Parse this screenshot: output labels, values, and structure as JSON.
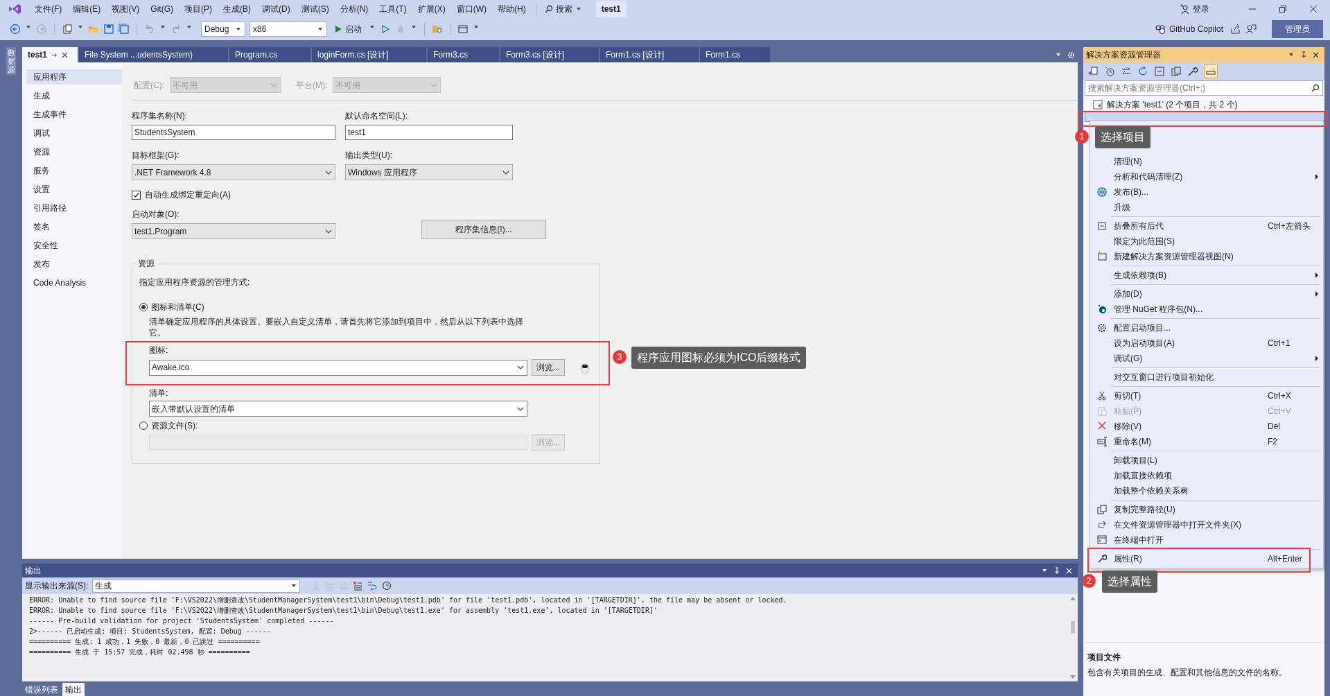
{
  "menu_bar": {
    "items": [
      "文件(F)",
      "编辑(E)",
      "视图(V)",
      "Git(G)",
      "项目(P)",
      "生成(B)",
      "调试(D)",
      "测试(S)",
      "分析(N)",
      "工具(T)",
      "扩展(X)",
      "窗口(W)",
      "帮助(H)"
    ],
    "search": "搜索",
    "title": "test1",
    "login": "登录"
  },
  "toolbar": {
    "configuration": "Debug",
    "platform": "x86",
    "start": "启动",
    "copilot": "GitHub Copilot",
    "admin": "管理员"
  },
  "side_tab": "数据源",
  "doc_tabs": [
    {
      "label": "test1",
      "selected": true
    },
    {
      "label": "File System ...udentsSystem)",
      "selected": false
    },
    {
      "label": "Program.cs",
      "selected": false
    },
    {
      "label": "loginForm.cs [设计]",
      "selected": false
    },
    {
      "label": "Form3.cs",
      "selected": false
    },
    {
      "label": "Form3.cs [设计]",
      "selected": false
    },
    {
      "label": "Form1.cs [设计]",
      "selected": false
    },
    {
      "label": "Form1.cs",
      "selected": false
    }
  ],
  "nav": [
    {
      "label": "应用程序",
      "selected": true
    },
    {
      "label": "生成",
      "selected": false
    },
    {
      "label": "生成事件",
      "selected": false
    },
    {
      "label": "调试",
      "selected": false
    },
    {
      "label": "资源",
      "selected": false
    },
    {
      "label": "服务",
      "selected": false
    },
    {
      "label": "设置",
      "selected": false
    },
    {
      "label": "引用路径",
      "selected": false
    },
    {
      "label": "签名",
      "selected": false
    },
    {
      "label": "安全性",
      "selected": false
    },
    {
      "label": "发布",
      "selected": false
    },
    {
      "label": "Code Analysis",
      "selected": false
    }
  ],
  "properties": {
    "configuration": {
      "label": "配置(C):",
      "value": "不可用",
      "disabled": true
    },
    "platform": {
      "label": "平台(M):",
      "value": "不可用",
      "disabled": true
    },
    "assembly_name": {
      "label": "程序集名称(N):",
      "value": "StudentsSystem"
    },
    "default_namespace": {
      "label": "默认命名空间(L):",
      "value": "test1"
    },
    "target_framework": {
      "label": "目标框架(G):",
      "value": ".NET Framework 4.8"
    },
    "output_type": {
      "label": "输出类型(U):",
      "value": "Windows 应用程序"
    },
    "auto_binding": {
      "label": "自动生成绑定重定向(A)",
      "checked": true
    },
    "startup_object": {
      "label": "启动对象(O):",
      "value": "test1.Program"
    },
    "assembly_info_button": "程序集信息(I)...",
    "resources": {
      "title": "资源",
      "hint": "指定应用程序资源的管理方式:",
      "options": [
        {
          "label": "图标和清单(C)",
          "selected": true
        },
        {
          "label": "资源文件(S):",
          "selected": false
        }
      ],
      "description": "清单确定应用程序的具体设置。要嵌入自定义清单，请首先将它添加到项目中，然后从以下列表中选择它。",
      "icon": {
        "label": "图标:",
        "value": "Awake.ico",
        "browse": "浏览..."
      },
      "manifest": {
        "label": "清单:",
        "value": "嵌入带默认设置的清单"
      },
      "resource_file": {
        "disabled": true,
        "browse": "浏览..."
      }
    }
  },
  "output": {
    "title": "输出",
    "source_label": "显示输出来源(S):",
    "source": "生成",
    "lines": [
      "ERROR: Unable to find source file 'F:\\VS2022\\增删查改\\StudentManagerSystem\\test1\\bin\\Debug\\test1.pdb' for file 'test1.pdb', located in '[TARGETDIR]', the file may be absent or locked.",
      "ERROR: Unable to find source file 'F:\\VS2022\\增删查改\\StudentManagerSystem\\test1\\bin\\Debug\\test1.exe' for assembly 'test1.exe', located in '[TARGETDIR]'",
      "------ Pre-build validation for project 'StudentsSystem' completed ------",
      "2>------ 已启动生成: 项目: StudentsSystem, 配置: Debug ------",
      "========== 生成: 1 成功，1 失败，0 最新，0 已跳过 ==========",
      "========== 生成 于 15:57 完成，耗时 02.498 秒 =========="
    ]
  },
  "bottom_tabs": [
    {
      "label": "错误列表",
      "selected": false
    },
    {
      "label": "输出",
      "selected": true
    }
  ],
  "solution_explorer": {
    "title": "解决方案资源管理器",
    "search_placeholder": "搜索解决方案资源管理器(Ctrl+;)",
    "solution": "解决方案 'test1' (2 个项目，共 2 个)",
    "info_title": "项目文件",
    "info_text": "包含有关项目的生成、配置和其他信息的文件的名称。"
  },
  "context_menu": {
    "groups": [
      [
        {
          "label": "清理(N)",
          "submenu": false,
          "disabled": false
        },
        {
          "label": "分析和代码清理(Z)",
          "submenu": true,
          "disabled": false
        },
        {
          "label": "发布(B)...",
          "submenu": false,
          "disabled": false
        },
        {
          "label": "升级",
          "submenu": false,
          "disabled": false
        }
      ],
      [
        {
          "label": "折叠所有后代",
          "shortcut": "Ctrl+左箭头",
          "submenu": false,
          "disabled": false
        },
        {
          "label": "限定为此范围(S)",
          "submenu": false,
          "disabled": false
        },
        {
          "label": "新建解决方案资源管理器视图(N)",
          "submenu": false,
          "disabled": false
        }
      ],
      [
        {
          "label": "生成依赖项(B)",
          "submenu": true,
          "disabled": false
        }
      ],
      [
        {
          "label": "添加(D)",
          "submenu": true,
          "disabled": false
        },
        {
          "label": "管理 NuGet 程序包(N)...",
          "submenu": false,
          "disabled": false
        }
      ],
      [
        {
          "label": "配置启动项目...",
          "submenu": false,
          "disabled": false
        },
        {
          "label": "设为启动项目(A)",
          "shortcut": "Ctrl+1",
          "submenu": false,
          "disabled": false
        },
        {
          "label": "调试(G)",
          "submenu": true,
          "disabled": false
        }
      ],
      [
        {
          "label": "对交互窗口进行项目初始化",
          "submenu": false,
          "disabled": false
        }
      ],
      [
        {
          "label": "剪切(T)",
          "shortcut": "Ctrl+X",
          "submenu": false,
          "disabled": false
        },
        {
          "label": "粘贴(P)",
          "shortcut": "Ctrl+V",
          "submenu": false,
          "disabled": true
        },
        {
          "label": "移除(V)",
          "shortcut": "Del",
          "submenu": false,
          "disabled": false
        },
        {
          "label": "重命名(M)",
          "shortcut": "F2",
          "submenu": false,
          "disabled": false
        }
      ],
      [
        {
          "label": "卸载项目(L)",
          "submenu": false,
          "disabled": false
        },
        {
          "label": "加载直接依赖项",
          "submenu": false,
          "disabled": false
        },
        {
          "label": "加载整个依赖关系树",
          "submenu": false,
          "disabled": false
        }
      ],
      [
        {
          "label": "复制完整路径(U)",
          "submenu": false,
          "disabled": false
        },
        {
          "label": "在文件资源管理器中打开文件夹(X)",
          "submenu": false,
          "disabled": false
        },
        {
          "label": "在终端中打开",
          "submenu": false,
          "disabled": false
        }
      ],
      [
        {
          "label": "属性(R)",
          "shortcut": "Alt+Enter",
          "submenu": false,
          "disabled": false
        }
      ]
    ]
  },
  "annotations": [
    {
      "number": "1",
      "text": "选择项目"
    },
    {
      "number": "2",
      "text": "选择属性"
    },
    {
      "number": "3",
      "text": "程序应用图标必须为ICO后缀格式"
    }
  ]
}
